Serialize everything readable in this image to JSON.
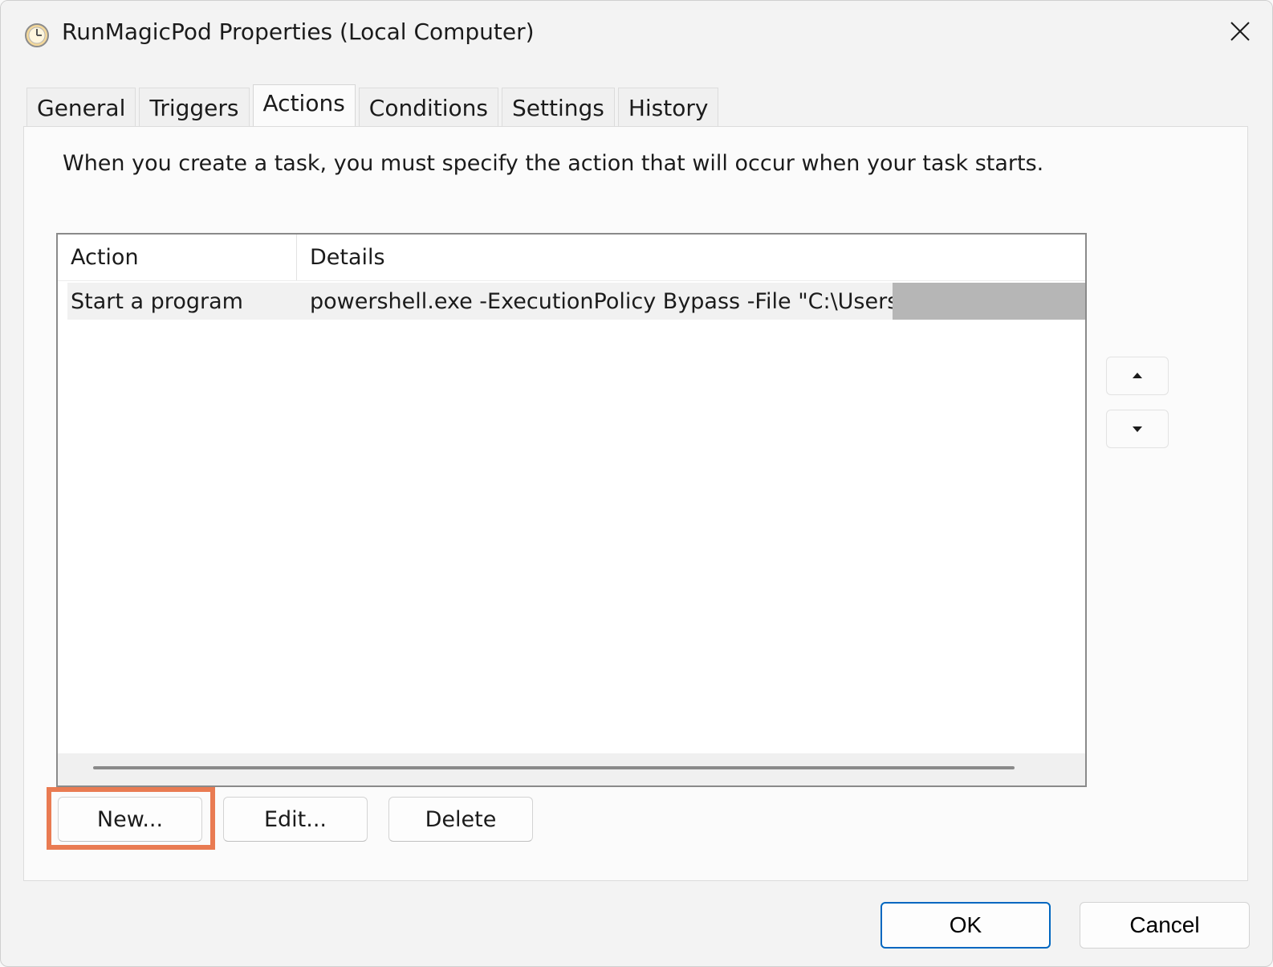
{
  "window": {
    "title": "RunMagicPod Properties (Local Computer)",
    "icon": "task-scheduler-clock-icon"
  },
  "tabs": [
    {
      "label": "General",
      "active": false
    },
    {
      "label": "Triggers",
      "active": false
    },
    {
      "label": "Actions",
      "active": true
    },
    {
      "label": "Conditions",
      "active": false
    },
    {
      "label": "Settings",
      "active": false
    },
    {
      "label": "History",
      "active": false
    }
  ],
  "panel": {
    "description": "When you create a task, you must specify the action that will occur when your task starts."
  },
  "list": {
    "columns": {
      "action": "Action",
      "details": "Details"
    },
    "rows": [
      {
        "action": "Start a program",
        "details": "powershell.exe -ExecutionPolicy Bypass -File \"C:\\Users\\"
      }
    ]
  },
  "buttons": {
    "new": "New...",
    "edit": "Edit...",
    "delete": "Delete",
    "ok": "OK",
    "cancel": "Cancel"
  },
  "colors": {
    "highlight": "#e97b52",
    "ok_border": "#0067c0",
    "redaction": "#b6b6b6"
  }
}
